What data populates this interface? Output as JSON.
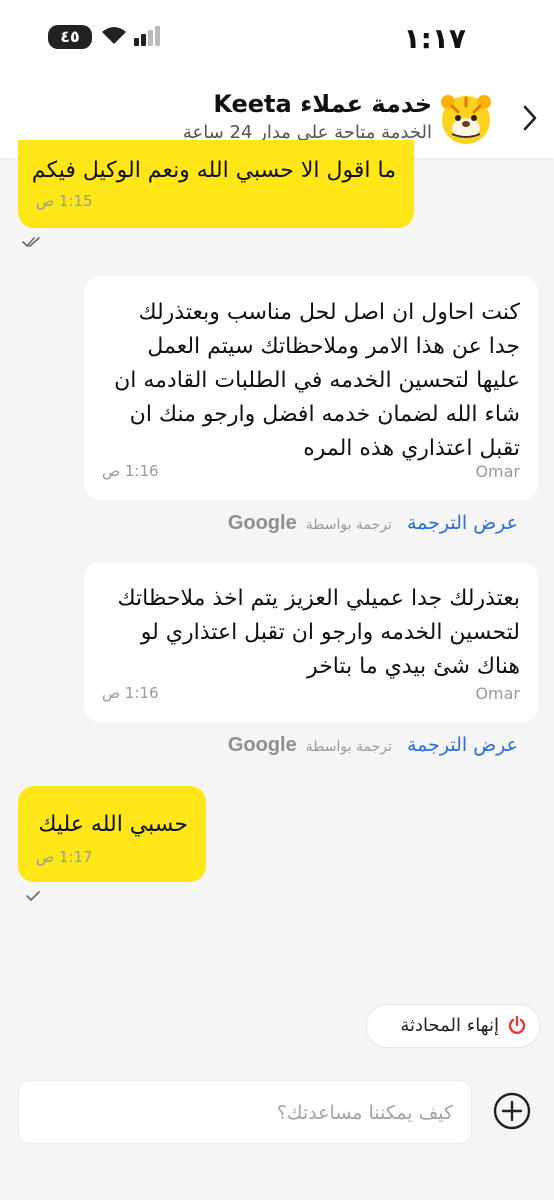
{
  "status_bar": {
    "time": "١:١٧",
    "battery": "٤٥"
  },
  "header": {
    "title": "خدمة عملاء Keeta",
    "subtitle": "الخدمة متاحة على مدار 24 ساعة"
  },
  "messages": [
    {
      "from": "user",
      "text": "ما اقول الا حسبي الله ونعم الوكيل فيكم",
      "time": "1:15 ص",
      "status": "read"
    },
    {
      "from": "agent",
      "sender": "Omar",
      "text": "كنت احاول ان اصل لحل مناسب وبعتذرلك\nجدا عن هذا الامر وملاحظاتك سيتم العمل\nعليها لتحسين الخدمه في الطلبات القادمه ان\nشاء الله لضمان خدمه افضل وارجو منك ان\nتقبل اعتذاري هذه المره",
      "time": "1:16 ص",
      "translate": {
        "link": "عرض الترجمة",
        "via": "ترجمة بواسطة",
        "brand": "Google"
      }
    },
    {
      "from": "agent",
      "sender": "Omar",
      "text": "بعتذرلك جدا عميلي العزيز يتم اخذ ملاحظاتك\nلتحسين الخدمه وارجو ان تقبل اعتذاري لو\nهناك شئ بيدي ما بتاخر",
      "time": "1:16 ص",
      "translate": {
        "link": "عرض الترجمة",
        "via": "ترجمة بواسطة",
        "brand": "Google"
      }
    },
    {
      "from": "user",
      "text": "حسبي الله عليك",
      "time": "1:17 ص",
      "status": "sent"
    }
  ],
  "end_chat_label": "إنهاء المحادثة",
  "composer": {
    "placeholder": "كيف يمكننا مساعدتك؟",
    "value": ""
  },
  "colors": {
    "user_bubble": "#ffe619",
    "agent_bubble": "#ffffff",
    "link": "#2b6fd6",
    "end_icon": "#e53935"
  }
}
